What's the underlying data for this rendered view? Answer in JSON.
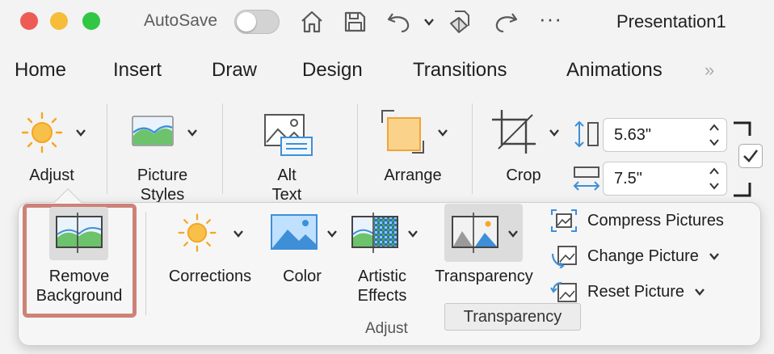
{
  "titlebar": {
    "autosave_label": "AutoSave",
    "autosave_on": false,
    "document_title": "Presentation1",
    "more_glyph": "···",
    "icons": [
      "home-icon",
      "save-icon",
      "undo-icon",
      "print-preview-icon",
      "redo-icon"
    ]
  },
  "tabs": [
    "Home",
    "Insert",
    "Draw",
    "Design",
    "Transitions",
    "Animations"
  ],
  "tabs_overflow_glyph": "»",
  "ribbon": {
    "adjust_label": "Adjust",
    "picture_styles_label_1": "Picture",
    "picture_styles_label_2": "Styles",
    "alt_text_label_1": "Alt",
    "alt_text_label_2": "Text",
    "arrange_label": "Arrange",
    "crop_label": "Crop",
    "height_value": "5.63\"",
    "width_value": "7.5\""
  },
  "adjust_popover": {
    "remove_background_1": "Remove",
    "remove_background_2": "Background",
    "corrections": "Corrections",
    "color": "Color",
    "artistic_effects_1": "Artistic",
    "artistic_effects_2": "Effects",
    "transparency": "Transparency",
    "compress_pictures": "Compress Pictures",
    "change_picture": "Change Picture",
    "reset_picture": "Reset Picture",
    "group_label": "Adjust",
    "tooltip": "Transparency"
  },
  "colors": {
    "accent_highlight": "#cd8278",
    "sun_orange": "#f5a623",
    "picture_blue": "#3e8fd8",
    "picture_green": "#6cc36c"
  }
}
